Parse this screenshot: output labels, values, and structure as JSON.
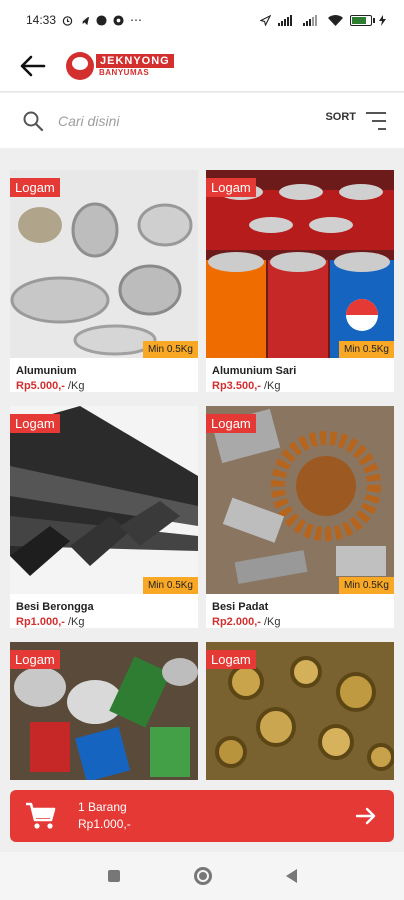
{
  "status_bar": {
    "time": "14:33",
    "dots": "⋯"
  },
  "header": {
    "logo_title": "JEKNYONG",
    "logo_sub": "BANYUMAS"
  },
  "search": {
    "placeholder": "Cari disini",
    "sort_label": "SORT"
  },
  "products": [
    {
      "badge": "Logam",
      "name": "Alumunium",
      "price": "Rp5.000,-",
      "unit": " /Kg",
      "min": "Min 0.5Kg",
      "image": "aluminium-pans"
    },
    {
      "badge": "Logam",
      "name": "Alumunium Sari",
      "price": "Rp3.500,-",
      "unit": " /Kg",
      "min": "Min 0.5Kg",
      "image": "soda-cans"
    },
    {
      "badge": "Logam",
      "name": "Besi Berongga",
      "price": "Rp1.000,-",
      "unit": " /Kg",
      "min": "Min 0.5Kg",
      "image": "hollow-steel-bars"
    },
    {
      "badge": "Logam",
      "name": "Besi Padat",
      "price": "Rp2.000,-",
      "unit": " /Kg",
      "min": "Min 0.5Kg",
      "image": "solid-iron-scrap"
    },
    {
      "badge": "Logam",
      "image": "tin-cans"
    },
    {
      "badge": "Logam",
      "image": "brass-fittings"
    }
  ],
  "cart": {
    "count_label": "1 Barang",
    "total": "Rp1.000,-"
  },
  "colors": {
    "accent": "#e53935",
    "min_badge": "#f9a825"
  }
}
